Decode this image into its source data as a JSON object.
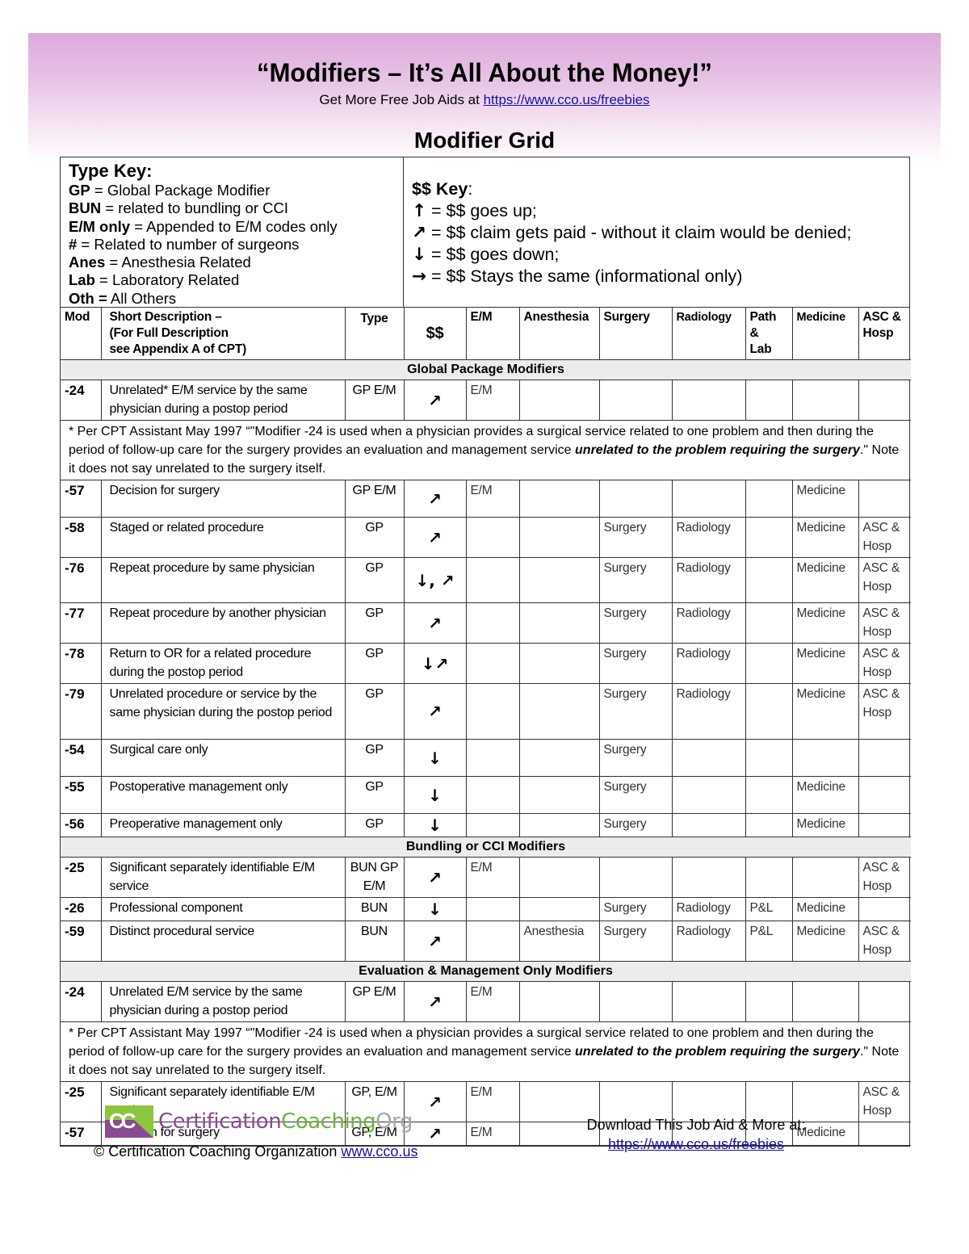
{
  "header": {
    "title": "“Modifiers – It’s All About the Money!”",
    "subtitle_prefix": "Get More Free Job Aids at ",
    "subtitle_link": "https://www.cco.us/freebies",
    "grid_title": "Modifier Grid"
  },
  "type_key": {
    "heading": "Type Key:",
    "items": [
      {
        "code": "GP",
        "sep": " = ",
        "desc": "Global Package Modifier"
      },
      {
        "code": "BUN",
        "sep": " = ",
        "desc": "related to bundling or CCI"
      },
      {
        "code": "E/M only",
        "sep": " = ",
        "desc": "Appended to E/M codes only"
      },
      {
        "code": "#",
        "sep": " = ",
        "desc": "Related to number of surgeons"
      },
      {
        "code": "Anes",
        "sep": " = ",
        "desc": "Anesthesia Related"
      },
      {
        "code": "Lab",
        "sep": " = ",
        "desc": "Laboratory Related"
      },
      {
        "code": "Oth =",
        "sep": " ",
        "desc": "All Others"
      }
    ]
  },
  "money_key": {
    "heading": "$$ Key",
    "heading_suffix": ":",
    "items": [
      {
        "icon": "arrow-up-icon",
        "glyph": "🡑",
        "text": " = $$ goes up;"
      },
      {
        "icon": "arrow-up-right-icon",
        "glyph": "➚",
        "text": " = $$ claim gets paid - without it claim would be denied;"
      },
      {
        "icon": "arrow-down-icon",
        "glyph": "🡓",
        "text": " = $$ goes down;"
      },
      {
        "icon": "arrow-right-icon",
        "glyph": "➔",
        "text": " = $$ Stays the same (informational only)"
      }
    ]
  },
  "glyphs": {
    "up": "↑",
    "up_right": "↗",
    "down": "↓",
    "right": "→"
  },
  "columns": {
    "mod": "Mod",
    "desc_1": "Short Description –",
    "desc_2": "(For Full Description",
    "desc_3": "see Appendix A of CPT)",
    "type": "Type",
    "money": "$$",
    "em": "E/M",
    "anesthesia": "Anesthesia",
    "surgery": "Surgery",
    "radiology": "Radiology",
    "path_1": "Path",
    "path_2": "&",
    "path_3": "Lab",
    "medicine": "Medicine",
    "asc_1": "ASC &",
    "asc_2": "Hosp"
  },
  "sections": [
    {
      "title": "Global Package Modifiers",
      "rows": [
        {
          "mod": "-24",
          "desc": "Unrelated* E/M service by the same physician during a postop period",
          "type": "GP E/M",
          "money": "↗",
          "em": "E/M",
          "anesthesia": "",
          "surgery": "",
          "radiology": "",
          "path": "",
          "medicine": "",
          "asc": ""
        },
        {
          "note": true,
          "text_1": "* Per CPT Assistant May 1997 “\"Modifier -24 is used when a physician provides a surgical service related to one problem and then during the period of follow-up care for the surgery provides an evaluation and management service ",
          "text_em": "unrelated to the problem requiring the surgery",
          "text_2": ".\" Note it does not say unrelated to the surgery itself."
        },
        {
          "mod": "-57",
          "desc": "Decision for surgery",
          "type": "GP E/M",
          "money": "↗",
          "em": "E/M",
          "anesthesia": "",
          "surgery": "",
          "radiology": "",
          "path": "",
          "medicine": "Medicine",
          "asc": ""
        },
        {
          "mod": "-58",
          "desc": "Staged or related procedure",
          "type": "GP",
          "money": "↗",
          "em": "",
          "anesthesia": "",
          "surgery": "Surgery",
          "radiology": "Radiology",
          "path": "",
          "medicine": "Medicine",
          "asc": "ASC & Hosp"
        },
        {
          "mod": "-76",
          "desc": "Repeat procedure by same physician",
          "type": "GP",
          "money": "↓, ↗",
          "em": "",
          "anesthesia": "",
          "surgery": "Surgery",
          "radiology": "Radiology",
          "path": "",
          "medicine": "Medicine",
          "asc": "ASC & Hosp"
        },
        {
          "mod": "-77",
          "desc": "Repeat procedure by another physician",
          "type": "GP",
          "money": "↗",
          "em": "",
          "anesthesia": "",
          "surgery": "Surgery",
          "radiology": "Radiology",
          "path": "",
          "medicine": "Medicine",
          "asc": "ASC & Hosp"
        },
        {
          "mod": "-78",
          "desc": "Return to OR for a related procedure during the postop period",
          "type": "GP",
          "money": "↓↗",
          "em": "",
          "anesthesia": "",
          "surgery": "Surgery",
          "radiology": "Radiology",
          "path": "",
          "medicine": "Medicine",
          "asc": "ASC & Hosp"
        },
        {
          "mod": "-79",
          "desc": "Unrelated procedure or service by the same physician during the postop period",
          "type": "GP",
          "money": "↗",
          "em": "",
          "anesthesia": "",
          "surgery": "Surgery",
          "radiology": "Radiology",
          "path": "",
          "medicine": "Medicine",
          "asc": "ASC & Hosp"
        },
        {
          "mod": "-54",
          "desc": "Surgical care only",
          "type": "GP",
          "money": "↓",
          "em": "",
          "anesthesia": "",
          "surgery": "Surgery",
          "radiology": "",
          "path": "",
          "medicine": "",
          "asc": ""
        },
        {
          "mod": "-55",
          "desc": "Postoperative management only",
          "type": "GP",
          "money": "↓",
          "em": "",
          "anesthesia": "",
          "surgery": "Surgery",
          "radiology": "",
          "path": "",
          "medicine": "Medicine",
          "asc": ""
        },
        {
          "mod": "-56",
          "desc": "Preoperative management only",
          "type": "GP",
          "money": "↓",
          "em": "",
          "anesthesia": "",
          "surgery": "Surgery",
          "radiology": "",
          "path": "",
          "medicine": "Medicine",
          "asc": ""
        }
      ]
    },
    {
      "title": "Bundling or CCI Modifiers",
      "rows": [
        {
          "mod": "-25",
          "desc": "Significant separately identifiable E/M service",
          "type": "BUN GP E/M",
          "money": "↗",
          "em": "E/M",
          "anesthesia": "",
          "surgery": "",
          "radiology": "",
          "path": "",
          "medicine": "",
          "asc": "ASC & Hosp"
        },
        {
          "mod": "-26",
          "desc": "Professional component",
          "type": "BUN",
          "money": "↓",
          "em": "",
          "anesthesia": "",
          "surgery": "Surgery",
          "radiology": "Radiology",
          "path": "P&L",
          "medicine": "Medicine",
          "asc": ""
        },
        {
          "mod": "-59",
          "desc": "Distinct procedural service",
          "type": "BUN",
          "money": "↗",
          "em": "",
          "anesthesia": "Anesthesia",
          "surgery": "Surgery",
          "radiology": "Radiology",
          "path": "P&L",
          "medicine": "Medicine",
          "asc": "ASC & Hosp"
        }
      ]
    },
    {
      "title": "Evaluation & Management Only Modifiers",
      "rows": [
        {
          "mod": "-24",
          "desc": "Unrelated E/M service by the same physician during a postop period",
          "type": "GP E/M",
          "money": "↗",
          "em": "E/M",
          "anesthesia": "",
          "surgery": "",
          "radiology": "",
          "path": "",
          "medicine": "",
          "asc": ""
        },
        {
          "note": true,
          "text_1": "* Per CPT Assistant May 1997 “\"Modifier -24 is used when a physician provides a surgical service related to one problem and then during the period of follow-up care for the surgery provides an evaluation and management service ",
          "text_em": "unrelated to the problem requiring the surgery",
          "text_2": ".\" Note it does not say unrelated to the surgery itself."
        },
        {
          "mod": "-25",
          "desc": "Significant separately identifiable E/M service",
          "type": "GP, E/M",
          "money": "↗",
          "em": "E/M",
          "anesthesia": "",
          "surgery": "",
          "radiology": "",
          "path": "",
          "medicine": "",
          "asc": "ASC & Hosp"
        },
        {
          "mod": "-57",
          "desc": "Decision for surgery",
          "type": "GP, E/M",
          "money": "↗",
          "em": "E/M",
          "anesthesia": "",
          "surgery": "",
          "radiology": "",
          "path": "",
          "medicine": "Medicine",
          "asc": ""
        }
      ]
    }
  ],
  "footer": {
    "logo_initials": "CC",
    "logo_part1": "Certification",
    "logo_part2": "Coaching",
    "logo_part3": "Org",
    "copyright_prefix": "© Certification Coaching Organization ",
    "copyright_link": "www.cco.us",
    "download_text": "Download This Job Aid & More at:",
    "download_link": "https://www.cco.us/freebies"
  },
  "colors": {
    "banner_top": "#dcaadb",
    "section_bg": "#ececec",
    "link": "#1a0dab",
    "logo_purple": "#8a4a8f",
    "logo_green": "#6cb33f",
    "logo_gray": "#a8a8a8"
  }
}
